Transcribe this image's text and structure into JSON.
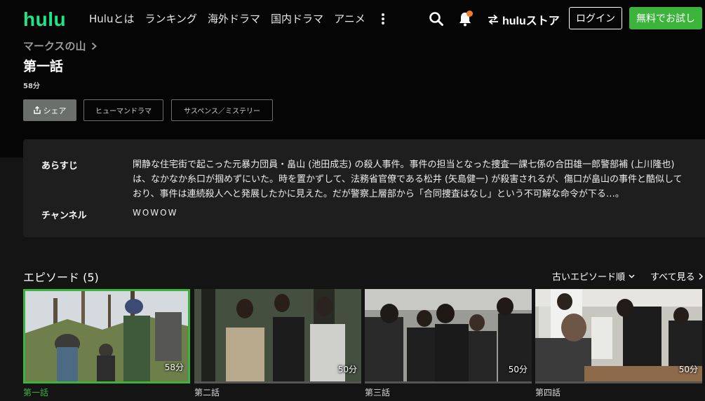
{
  "header": {
    "logo": "hulu",
    "nav": [
      "Huluとは",
      "ランキング",
      "海外ドラマ",
      "国内ドラマ",
      "アニメ"
    ],
    "store_label": "huluストア",
    "login_label": "ログイン",
    "trial_label": "無料でお試し",
    "colors": {
      "brand": "#1ce783",
      "trial": "#3cb43c",
      "notification": "#f37b2a"
    }
  },
  "detail": {
    "breadcrumb": "マークスの山",
    "title": "第一話",
    "duration": "58分",
    "share_label": "シェア",
    "tags": [
      "ヒューマンドラマ",
      "サスペンス／ミステリー"
    ]
  },
  "info": {
    "synopsis_label": "あらすじ",
    "synopsis": "閑静な住宅街で起こった元暴力団員・畠山 (池田成志) の殺人事件。事件の担当となった捜査一課七係の合田雄一郎警部補 (上川隆也) は、なかなか糸口が掴めずにいた。時を置かずして、法務省官僚である松井 (矢島健一) が殺害されるが、傷口が畠山の事件と酷似しており、事件は連続殺人へと発展したかに見えた。だが警察上層部から「合同捜査はなし」という不可解な命令が下る…。",
    "channel_label": "チャンネル",
    "channel": "WOWOW"
  },
  "episodes": {
    "heading": "エピソード (5)",
    "sort_label": "古いエピソード順",
    "see_all_label": "すべて見る",
    "items": [
      {
        "title": "第一話",
        "duration": "58分",
        "active": true
      },
      {
        "title": "第二話",
        "duration": "50分",
        "active": false
      },
      {
        "title": "第三話",
        "duration": "50分",
        "active": false
      },
      {
        "title": "第四話",
        "duration": "50分",
        "active": false
      }
    ]
  },
  "icons": [
    "search-icon",
    "bell-icon",
    "switch-arrows-icon",
    "chevron-right-icon",
    "share-icon",
    "chevron-down-icon",
    "more-vertical-icon"
  ]
}
